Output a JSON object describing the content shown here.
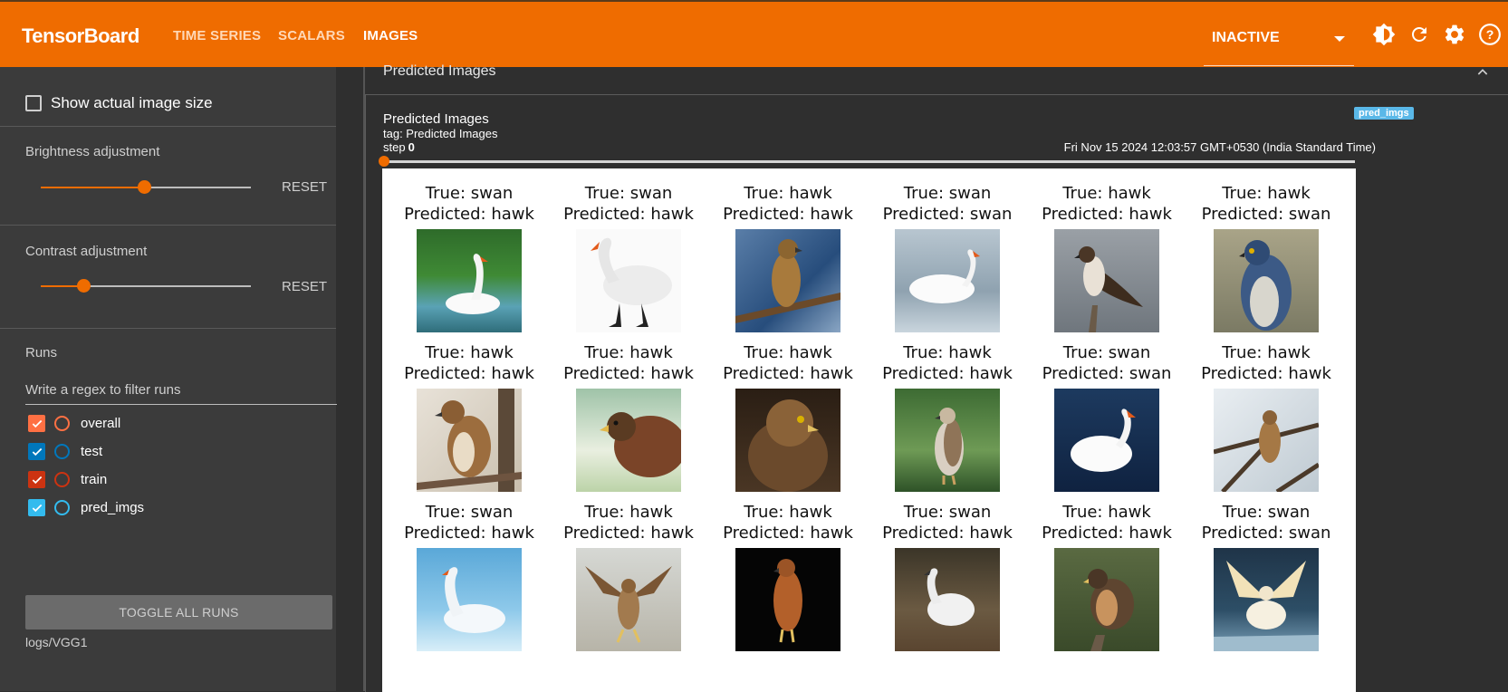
{
  "topbar": {
    "brand": "TensorBoard",
    "tabs": [
      {
        "label": "TIME SERIES"
      },
      {
        "label": "SCALARS"
      },
      {
        "label": "IMAGES"
      }
    ],
    "reload_dropdown": "INACTIVE",
    "icons": [
      "theme-toggle-icon",
      "refresh-icon",
      "settings-icon",
      "help-icon"
    ],
    "color": "#ef6c00"
  },
  "sidebar": {
    "show_actual_size_label": "Show actual image size",
    "brightness_label": "Brightness adjustment",
    "brightness_value": 0.5,
    "contrast_label": "Contrast adjustment",
    "contrast_value": 0.2,
    "reset_label": "RESET",
    "runs_title": "Runs",
    "filter_placeholder": "Write a regex to filter runs",
    "runs": [
      {
        "name": "overall",
        "color": "#ff7043",
        "checked": true
      },
      {
        "name": "test",
        "color": "#0077bb",
        "checked": true
      },
      {
        "name": "train",
        "color": "#cc3311",
        "checked": true
      },
      {
        "name": "pred_imgs",
        "color": "#33bbee",
        "checked": true
      }
    ],
    "toggle_all_label": "TOGGLE ALL RUNS",
    "log_dir": "logs/VGG1"
  },
  "main": {
    "section_title": "Predicted Images",
    "card": {
      "title": "Predicted Images",
      "tag": "tag: Predicted Images",
      "step_label": "step",
      "step_value": "0",
      "run_badge": "pred_imgs",
      "timestamp": "Fri Nov 15 2024 12:03:57 GMT+0530 (India Standard Time)",
      "images": [
        {
          "true": "True: swan",
          "pred": "Predicted: hawk"
        },
        {
          "true": "True: swan",
          "pred": "Predicted: hawk"
        },
        {
          "true": "True: hawk",
          "pred": "Predicted: hawk"
        },
        {
          "true": "True: swan",
          "pred": "Predicted: swan"
        },
        {
          "true": "True: hawk",
          "pred": "Predicted: hawk"
        },
        {
          "true": "True: hawk",
          "pred": "Predicted: swan"
        },
        {
          "true": "True: hawk",
          "pred": "Predicted: hawk"
        },
        {
          "true": "True: hawk",
          "pred": "Predicted: hawk"
        },
        {
          "true": "True: hawk",
          "pred": "Predicted: hawk"
        },
        {
          "true": "True: hawk",
          "pred": "Predicted: hawk"
        },
        {
          "true": "True: swan",
          "pred": "Predicted: swan"
        },
        {
          "true": "True: hawk",
          "pred": "Predicted: hawk"
        },
        {
          "true": "True: swan",
          "pred": "Predicted: hawk"
        },
        {
          "true": "True: hawk",
          "pred": "Predicted: hawk"
        },
        {
          "true": "True: hawk",
          "pred": "Predicted: hawk"
        },
        {
          "true": "True: swan",
          "pred": "Predicted: hawk"
        },
        {
          "true": "True: hawk",
          "pred": "Predicted: hawk"
        },
        {
          "true": "True: swan",
          "pred": "Predicted: swan"
        }
      ]
    }
  }
}
